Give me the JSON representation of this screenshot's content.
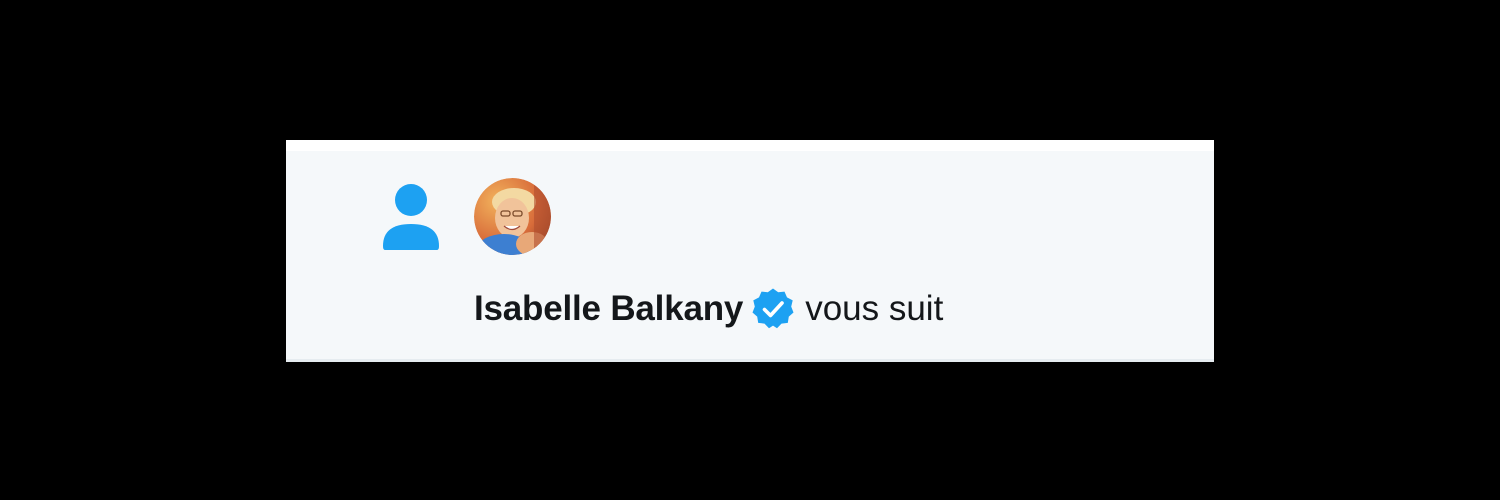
{
  "notification": {
    "type_icon": "person-follow-icon",
    "accent_color": "#1da1f2",
    "avatar_icon": "user-avatar-photo",
    "user_name": "Isabelle Balkany",
    "verified_icon": "verified-badge-icon",
    "action_text": "vous suit"
  }
}
